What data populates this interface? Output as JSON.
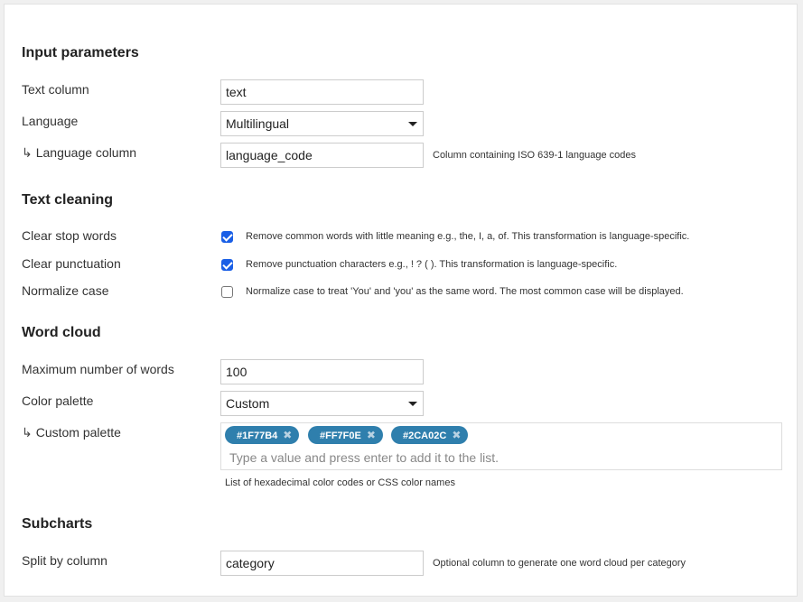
{
  "sections": {
    "input": {
      "title": "Input parameters",
      "text_column": {
        "label": "Text column",
        "value": "text"
      },
      "language": {
        "label": "Language",
        "value": "Multilingual"
      },
      "language_column": {
        "arrow": "↳",
        "label": "Language column",
        "value": "language_code",
        "help": "Column containing ISO 639-1 language codes"
      }
    },
    "cleaning": {
      "title": "Text cleaning",
      "stop_words": {
        "label": "Clear stop words",
        "checked": true,
        "description": "Remove common words with little meaning e.g., the, I, a, of. This transformation is language-specific."
      },
      "punctuation": {
        "label": "Clear punctuation",
        "checked": true,
        "description": "Remove punctuation characters e.g., ! ? ( ). This transformation is language-specific."
      },
      "normalize_case": {
        "label": "Normalize case",
        "checked": false,
        "description": "Normalize case to treat 'You' and 'you' as the same word. The most common case will be displayed."
      }
    },
    "wordcloud": {
      "title": "Word cloud",
      "max_words": {
        "label": "Maximum number of words",
        "value": "100"
      },
      "color_palette": {
        "label": "Color palette",
        "value": "Custom"
      },
      "custom_palette": {
        "arrow": "↳",
        "label": "Custom palette",
        "tags": [
          "#1F77B4",
          "#FF7F0E",
          "#2CA02C"
        ],
        "remove_glyph": "✖",
        "placeholder": "Type a value and press enter to add it to the list.",
        "help": "List of hexadecimal color codes or CSS color names"
      }
    },
    "subcharts": {
      "title": "Subcharts",
      "split_by": {
        "label": "Split by column",
        "value": "category",
        "help": "Optional column to generate one word cloud per category"
      }
    }
  },
  "colors": {
    "accent": "#2f7fad",
    "checkbox": "#1a5fe6"
  }
}
